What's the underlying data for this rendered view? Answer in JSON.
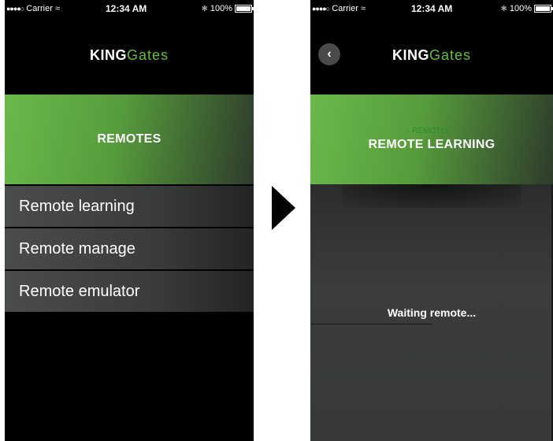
{
  "status_bar": {
    "carrier": "Carrier",
    "signal_dots": "●●●●○",
    "time": "12:34 AM",
    "battery": "100%"
  },
  "brand": {
    "king": "KING",
    "gates": "Gates"
  },
  "left_screen": {
    "banner_title": "REMOTES",
    "menu": [
      {
        "label": "Remote learning"
      },
      {
        "label": "Remote manage"
      },
      {
        "label": "Remote emulator"
      }
    ]
  },
  "right_screen": {
    "back_icon": "chevron-left-icon",
    "banner_subtitle": "- REMOTES -",
    "banner_title": "REMOTE LEARNING",
    "status_text": "Waiting remote..."
  },
  "colors": {
    "accent_green": "#5fbf3a",
    "banner_green": "#6ab94a",
    "subtitle_green": "#2f8a2b",
    "background": "#000000"
  }
}
